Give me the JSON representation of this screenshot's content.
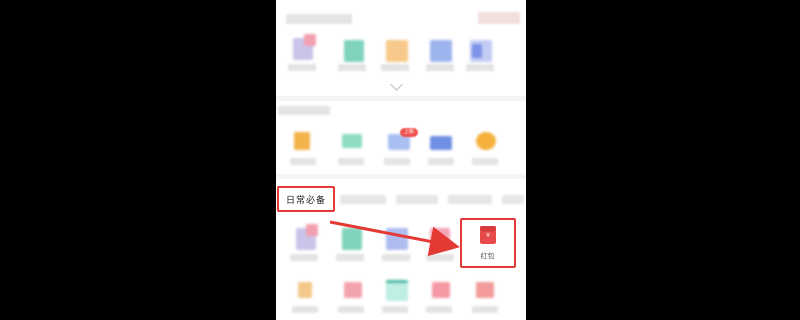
{
  "tabs": {
    "active_label": "日常必备"
  },
  "featured_item": {
    "label": "红包",
    "icon_glyph": "¥",
    "icon_name": "red-packet-icon"
  },
  "badge_text": "上新",
  "colors": {
    "highlight": "#e53935",
    "red_packet": "#e64a4a",
    "background": "#000000"
  }
}
